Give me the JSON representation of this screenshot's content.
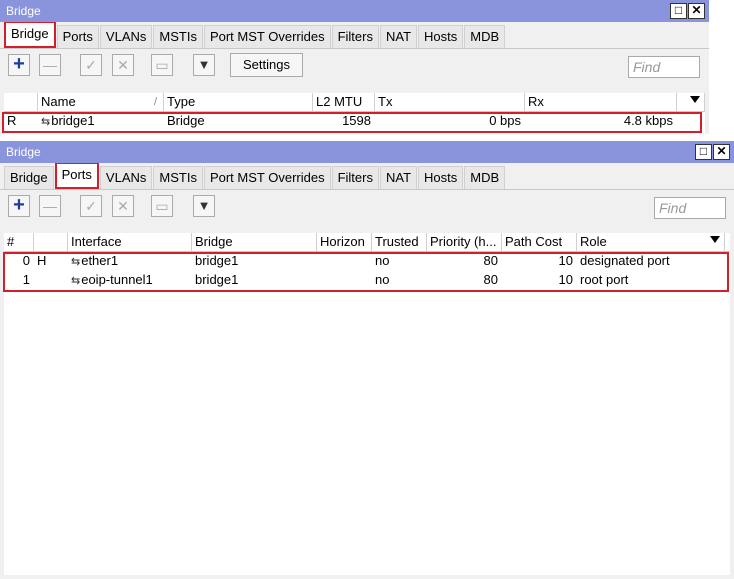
{
  "win1": {
    "title": "Bridge",
    "tabs": [
      "Bridge",
      "Ports",
      "VLANs",
      "MSTIs",
      "Port MST Overrides",
      "Filters",
      "NAT",
      "Hosts",
      "MDB"
    ],
    "settings_label": "Settings",
    "find_placeholder": "Find",
    "columns": [
      "",
      "Name",
      "Type",
      "L2 MTU",
      "Tx",
      "Rx"
    ],
    "rows": [
      {
        "flag": "R",
        "name": "bridge1",
        "type": "Bridge",
        "l2mtu": "1598",
        "tx": "0 bps",
        "rx": "4.8 kbps"
      }
    ]
  },
  "win2": {
    "title": "Bridge",
    "tabs": [
      "Bridge",
      "Ports",
      "VLANs",
      "MSTIs",
      "Port MST Overrides",
      "Filters",
      "NAT",
      "Hosts",
      "MDB"
    ],
    "find_placeholder": "Find",
    "columns": [
      "#",
      "",
      "Interface",
      "Bridge",
      "Horizon",
      "Trusted",
      "Priority (h...",
      "Path Cost",
      "Role"
    ],
    "rows": [
      {
        "num": "0",
        "flag": "H",
        "interface": "ether1",
        "bridge": "bridge1",
        "horizon": "",
        "trusted": "no",
        "priority": "80",
        "path_cost": "10",
        "role": "designated port"
      },
      {
        "num": "1",
        "flag": "",
        "interface": "eoip-tunnel1",
        "bridge": "bridge1",
        "horizon": "",
        "trusted": "no",
        "priority": "80",
        "path_cost": "10",
        "role": "root port"
      }
    ]
  },
  "colors": {
    "titlebar": "#8a94dc",
    "highlight": "#d21f2a",
    "plus": "#1a3fa0"
  },
  "icons": {
    "add": "plus-icon",
    "remove": "minus-icon",
    "enable": "check-icon",
    "disable": "cross-icon",
    "comment": "comment-icon",
    "filter": "filter-icon",
    "interface": "interface-icon"
  }
}
